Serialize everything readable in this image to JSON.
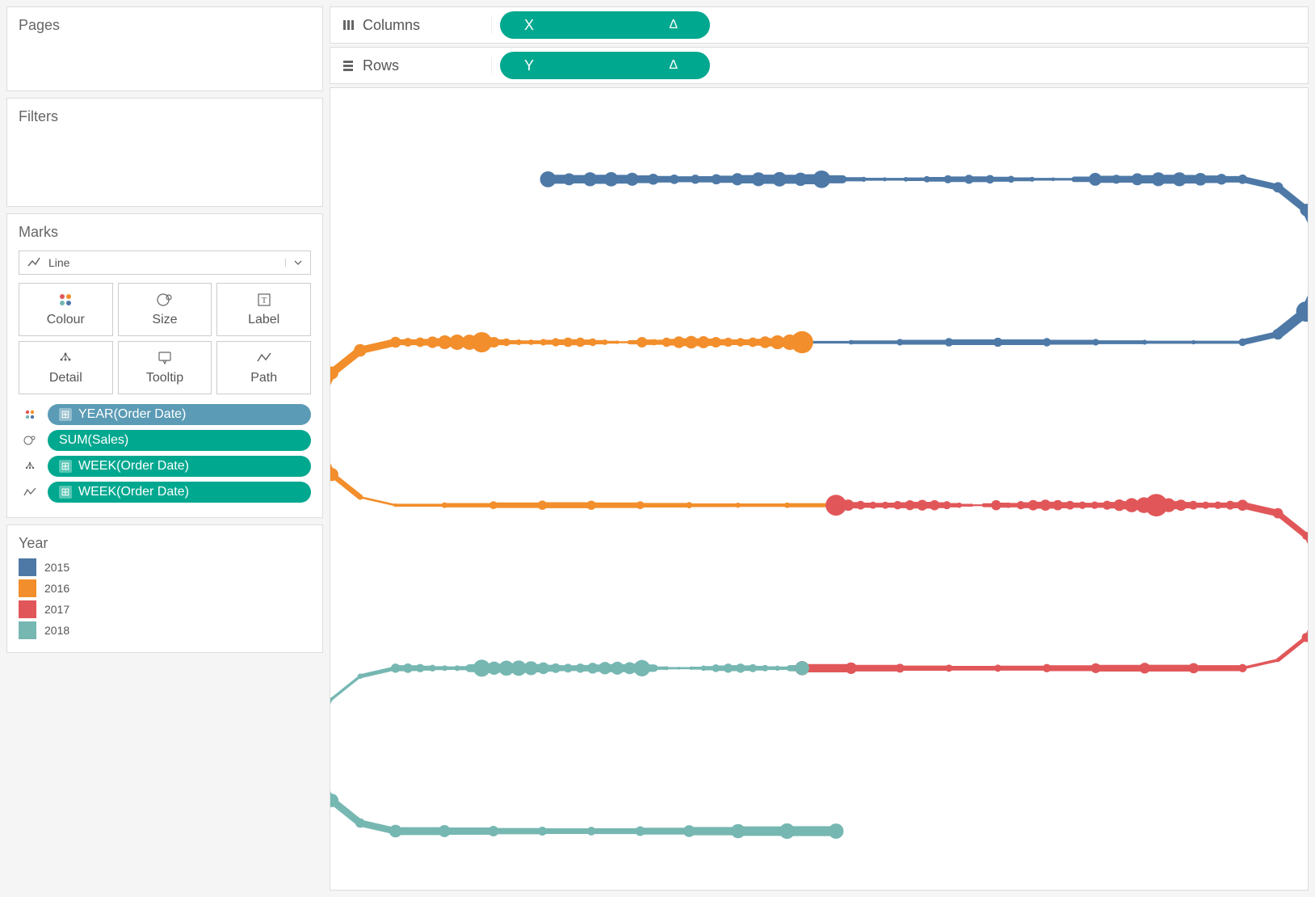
{
  "shelves": {
    "pages_label": "Pages",
    "filters_label": "Filters",
    "columns_label": "Columns",
    "rows_label": "Rows",
    "columns_pill": "X",
    "rows_pill": "Y",
    "delta_symbol": "Δ"
  },
  "marks": {
    "title": "Marks",
    "type_selected": "Line",
    "buttons": {
      "colour": "Colour",
      "size": "Size",
      "label": "Label",
      "detail": "Detail",
      "tooltip": "Tooltip",
      "path": "Path"
    },
    "assignments": [
      {
        "slot": "colour",
        "pill_text": "YEAR(Order Date)",
        "pill_colour": "blue",
        "has_plus": true
      },
      {
        "slot": "size",
        "pill_text": "SUM(Sales)",
        "pill_colour": "green",
        "has_plus": false
      },
      {
        "slot": "detail",
        "pill_text": "WEEK(Order Date)",
        "pill_colour": "green",
        "has_plus": true
      },
      {
        "slot": "path",
        "pill_text": "WEEK(Order Date)",
        "pill_colour": "green",
        "has_plus": true
      }
    ]
  },
  "legend": {
    "title": "Year",
    "items": [
      {
        "label": "2015",
        "colour": "#4e79a7"
      },
      {
        "label": "2016",
        "colour": "#f28e2b"
      },
      {
        "label": "2017",
        "colour": "#e15759"
      },
      {
        "label": "2018",
        "colour": "#76b7b2"
      }
    ]
  },
  "colours": {
    "pill_green": "#00a88f",
    "pill_blue": "#5b9bb5",
    "series_2015": "#4e79a7",
    "series_2016": "#f28e2b",
    "series_2017": "#e15759",
    "series_2018": "#76b7b2"
  },
  "chart_data": {
    "type": "line",
    "description": "Serpentine timeline of weekly SUM(Sales) by WEEK(Order Date), coloured by YEAR(Order Date), line width encodes sales magnitude. Weeks snake left→right then right→left across four rows (one per year) on a custom X/Y table-calc layout.",
    "x_field": "X (table calc)",
    "y_field": "Y (table calc)",
    "size_field": "SUM(Sales)",
    "colour_field": "YEAR(Order Date)",
    "detail_field": "WEEK(Order Date)",
    "path_field": "WEEK(Order Date)",
    "series": [
      {
        "name": "2015",
        "colour": "#4e79a7",
        "weeks": 52
      },
      {
        "name": "2016",
        "colour": "#f28e2b",
        "weeks": 52
      },
      {
        "name": "2017",
        "colour": "#e15759",
        "weeks": 52
      },
      {
        "name": "2018",
        "colour": "#76b7b2",
        "weeks": 52
      }
    ]
  }
}
